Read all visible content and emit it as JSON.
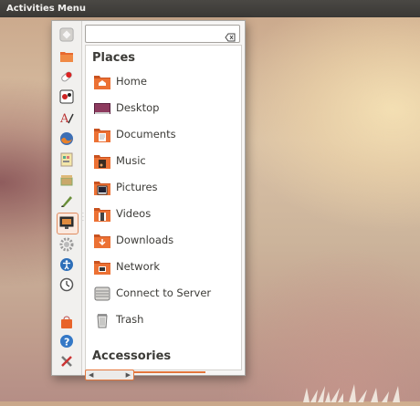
{
  "top_panel": {
    "activities_label": "Activities",
    "menu_label": "Menu"
  },
  "search": {
    "value": "",
    "placeholder": ""
  },
  "sidebar": {
    "icons": [
      "launcher-home-icon",
      "files-folder-icon",
      "pill-app-icon",
      "media-player-icon",
      "text-editor-icon",
      "firefox-icon",
      "spreadsheet-icon",
      "archive-icon",
      "pen-tool-icon",
      "remote-desktop-icon",
      "settings-gear-icon",
      "accessibility-icon",
      "clock-icon",
      "shopping-bag-icon",
      "help-icon",
      "system-tools-icon"
    ]
  },
  "places": {
    "title": "Places",
    "items": [
      {
        "label": "Home",
        "icon": "home-folder-icon"
      },
      {
        "label": "Desktop",
        "icon": "desktop-icon"
      },
      {
        "label": "Documents",
        "icon": "documents-folder-icon"
      },
      {
        "label": "Music",
        "icon": "music-folder-icon"
      },
      {
        "label": "Pictures",
        "icon": "pictures-folder-icon"
      },
      {
        "label": "Videos",
        "icon": "videos-folder-icon"
      },
      {
        "label": "Downloads",
        "icon": "downloads-folder-icon"
      },
      {
        "label": "Network",
        "icon": "network-folder-icon"
      },
      {
        "label": "Connect to Server",
        "icon": "server-icon"
      },
      {
        "label": "Trash",
        "icon": "trash-icon"
      }
    ]
  },
  "accessories": {
    "title": "Accessories"
  },
  "colors": {
    "accent": "#e3763c",
    "panel": "#3c3b37",
    "folder": "#e8692f"
  }
}
